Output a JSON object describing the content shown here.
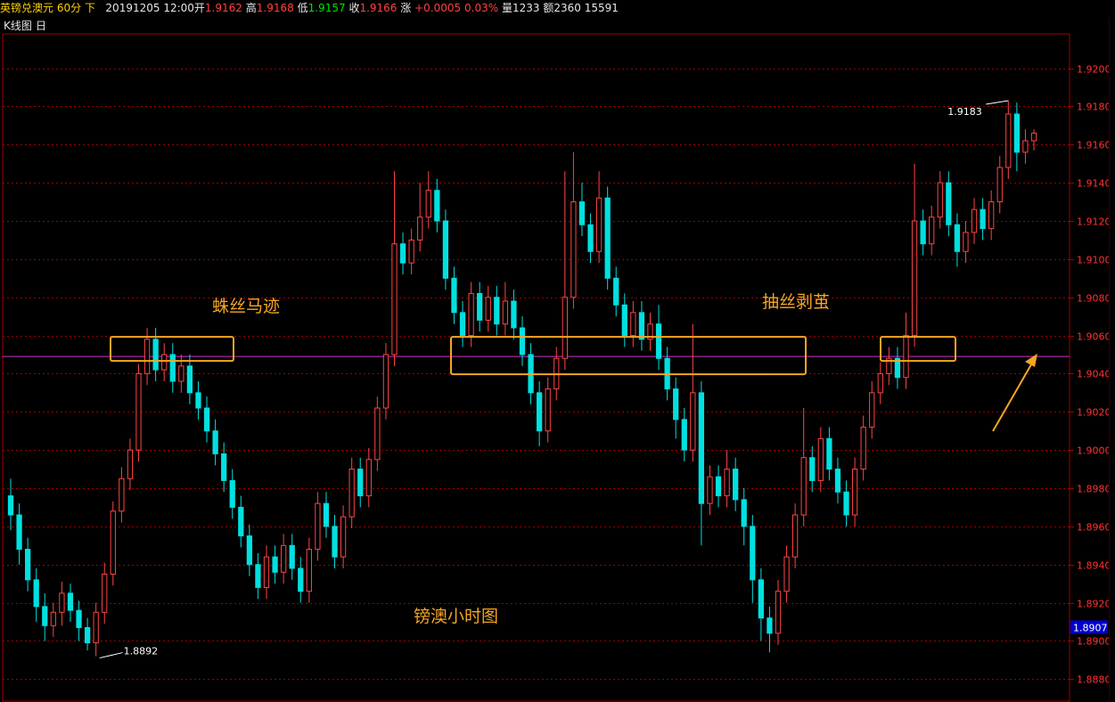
{
  "header": {
    "symbol": "英镑兑澳元",
    "period": "60分",
    "nav": "下",
    "datetime": "20191205 12:00",
    "open_label": "开",
    "open": "1.9162",
    "high_label": "高",
    "high": "1.9168",
    "low_label": "低",
    "low": "1.9157",
    "close_label": "收",
    "close": "1.9166",
    "change_label": "涨",
    "change": "+0.0005",
    "change_pct": "0.03%",
    "volume_label": "量",
    "volume": "1233",
    "amount_label": "额",
    "amount": "2360",
    "extra": "15591"
  },
  "tab": {
    "label": "K线图",
    "toggle": "日"
  },
  "colors": {
    "up": "#ff4444",
    "down": "#00e0e0",
    "grid": "#a00000",
    "axis_text": "#ff3333",
    "highlight_box": "#f5a623",
    "level_line": "#cc33cc",
    "annotation_text": "#f5a623",
    "price_tag_bg": "#0000cc"
  },
  "chart_data": {
    "type": "candlestick",
    "title": "镑澳小时图",
    "ylim": [
      1.8868,
      1.9218
    ],
    "yticks": [
      "1.9200",
      "1.9180",
      "1.9160",
      "1.9140",
      "1.9120",
      "1.9100",
      "1.9080",
      "1.9060",
      "1.9040",
      "1.9020",
      "1.9000",
      "1.8980",
      "1.8960",
      "1.8940",
      "1.8920",
      "1.8900",
      "1.8880"
    ],
    "grid": true,
    "current_price": "1.8907",
    "level_line": 1.9049,
    "high_marker": "1.9183",
    "low_marker": "1.8892",
    "annotations": [
      "蛛丝马迹",
      "抽丝剥茧",
      "镑澳小时图"
    ],
    "candles": [
      [
        1.8976,
        1.8966,
        1.8985,
        1.8958
      ],
      [
        1.8966,
        1.8948,
        1.8972,
        1.894
      ],
      [
        1.8948,
        1.8932,
        1.8954,
        1.8926
      ],
      [
        1.8932,
        1.8918,
        1.8938,
        1.891
      ],
      [
        1.8918,
        1.8908,
        1.8925,
        1.89
      ],
      [
        1.8908,
        1.8915,
        1.892,
        1.8902
      ],
      [
        1.8915,
        1.8925,
        1.8931,
        1.8908
      ],
      [
        1.8925,
        1.8916,
        1.893,
        1.891
      ],
      [
        1.8916,
        1.8907,
        1.8921,
        1.89
      ],
      [
        1.8907,
        1.8899,
        1.8912,
        1.8895
      ],
      [
        1.8899,
        1.8915,
        1.892,
        1.8892
      ],
      [
        1.8915,
        1.8935,
        1.8941,
        1.8909
      ],
      [
        1.8935,
        1.8968,
        1.8973,
        1.8929
      ],
      [
        1.8968,
        1.8985,
        1.8991,
        1.8962
      ],
      [
        1.8985,
        1.9,
        1.9006,
        1.8979
      ],
      [
        1.9,
        1.904,
        1.9045,
        1.8994
      ],
      [
        1.904,
        1.9058,
        1.9064,
        1.9034
      ],
      [
        1.9058,
        1.9042,
        1.9064,
        1.9036
      ],
      [
        1.9042,
        1.905,
        1.9056,
        1.9036
      ],
      [
        1.905,
        1.9036,
        1.9056,
        1.903
      ],
      [
        1.9036,
        1.9044,
        1.905,
        1.903
      ],
      [
        1.9044,
        1.903,
        1.905,
        1.9024
      ],
      [
        1.903,
        1.9022,
        1.9036,
        1.9016
      ],
      [
        1.9022,
        1.901,
        1.9028,
        1.9004
      ],
      [
        1.901,
        1.8998,
        1.9016,
        1.8992
      ],
      [
        1.8998,
        1.8984,
        1.9004,
        1.8978
      ],
      [
        1.8984,
        1.897,
        1.899,
        1.8964
      ],
      [
        1.897,
        1.8955,
        1.8976,
        1.8949
      ],
      [
        1.8955,
        1.894,
        1.8961,
        1.8934
      ],
      [
        1.894,
        1.8928,
        1.8946,
        1.8922
      ],
      [
        1.8928,
        1.8944,
        1.895,
        1.8922
      ],
      [
        1.8944,
        1.8936,
        1.895,
        1.893
      ],
      [
        1.8936,
        1.895,
        1.8956,
        1.893
      ],
      [
        1.895,
        1.8938,
        1.8956,
        1.8932
      ],
      [
        1.8938,
        1.8926,
        1.8944,
        1.892
      ],
      [
        1.8926,
        1.8948,
        1.8954,
        1.892
      ],
      [
        1.8948,
        1.8972,
        1.8978,
        1.8942
      ],
      [
        1.8972,
        1.896,
        1.8978,
        1.8954
      ],
      [
        1.896,
        1.8944,
        1.8966,
        1.8938
      ],
      [
        1.8944,
        1.8965,
        1.8971,
        1.8938
      ],
      [
        1.8965,
        1.899,
        1.8996,
        1.8959
      ],
      [
        1.899,
        1.8976,
        1.8996,
        1.897
      ],
      [
        1.8976,
        1.8995,
        1.9001,
        1.897
      ],
      [
        1.8995,
        1.9022,
        1.9028,
        1.8989
      ],
      [
        1.9022,
        1.905,
        1.9056,
        1.9016
      ],
      [
        1.905,
        1.9108,
        1.9146,
        1.9044
      ],
      [
        1.9108,
        1.9098,
        1.9114,
        1.9092
      ],
      [
        1.9098,
        1.911,
        1.9116,
        1.9092
      ],
      [
        1.911,
        1.9122,
        1.914,
        1.9104
      ],
      [
        1.9122,
        1.9136,
        1.9146,
        1.9116
      ],
      [
        1.9136,
        1.912,
        1.9142,
        1.9114
      ],
      [
        1.912,
        1.909,
        1.9126,
        1.9084
      ],
      [
        1.909,
        1.9072,
        1.9096,
        1.9066
      ],
      [
        1.9072,
        1.906,
        1.9078,
        1.9054
      ],
      [
        1.906,
        1.9082,
        1.9088,
        1.9054
      ],
      [
        1.9082,
        1.9068,
        1.9088,
        1.9062
      ],
      [
        1.9068,
        1.908,
        1.9086,
        1.9062
      ],
      [
        1.908,
        1.9066,
        1.9086,
        1.906
      ],
      [
        1.9066,
        1.9078,
        1.9088,
        1.906
      ],
      [
        1.9078,
        1.9064,
        1.9084,
        1.9058
      ],
      [
        1.9064,
        1.905,
        1.907,
        1.9044
      ],
      [
        1.905,
        1.903,
        1.9056,
        1.9024
      ],
      [
        1.903,
        1.901,
        1.9036,
        1.9002
      ],
      [
        1.901,
        1.9032,
        1.9038,
        1.9004
      ],
      [
        1.9032,
        1.9048,
        1.9054,
        1.9026
      ],
      [
        1.9048,
        1.908,
        1.9146,
        1.9042
      ],
      [
        1.908,
        1.913,
        1.9156,
        1.9074
      ],
      [
        1.913,
        1.9118,
        1.914,
        1.9112
      ],
      [
        1.9118,
        1.9104,
        1.9124,
        1.9098
      ],
      [
        1.9104,
        1.9132,
        1.9146,
        1.9098
      ],
      [
        1.9132,
        1.909,
        1.9138,
        1.9084
      ],
      [
        1.909,
        1.9076,
        1.9096,
        1.907
      ],
      [
        1.9076,
        1.906,
        1.9082,
        1.9054
      ],
      [
        1.906,
        1.9072,
        1.9078,
        1.9054
      ],
      [
        1.9072,
        1.9058,
        1.9078,
        1.9052
      ],
      [
        1.9058,
        1.9066,
        1.9072,
        1.9052
      ],
      [
        1.9066,
        1.9048,
        1.9076,
        1.9042
      ],
      [
        1.9048,
        1.9032,
        1.9054,
        1.9026
      ],
      [
        1.9032,
        1.9016,
        1.9038,
        1.9006
      ],
      [
        1.9016,
        1.9,
        1.9022,
        1.8994
      ],
      [
        1.9,
        1.903,
        1.9066,
        1.8994
      ],
      [
        1.903,
        1.8972,
        1.9036,
        1.895
      ],
      [
        1.8972,
        1.8986,
        1.8992,
        1.8966
      ],
      [
        1.8986,
        1.8976,
        1.8992,
        1.897
      ],
      [
        1.8976,
        1.899,
        1.9,
        1.897
      ],
      [
        1.899,
        1.8974,
        1.8996,
        1.8968
      ],
      [
        1.8974,
        1.896,
        1.898,
        1.895
      ],
      [
        1.896,
        1.8932,
        1.8966,
        1.892
      ],
      [
        1.8932,
        1.8912,
        1.8938,
        1.89
      ],
      [
        1.8912,
        1.8904,
        1.8918,
        1.8894
      ],
      [
        1.8904,
        1.8926,
        1.8932,
        1.8898
      ],
      [
        1.8926,
        1.8944,
        1.895,
        1.892
      ],
      [
        1.8944,
        1.8966,
        1.8972,
        1.8938
      ],
      [
        1.8966,
        1.8996,
        1.9022,
        1.896
      ],
      [
        1.8996,
        1.8984,
        1.9002,
        1.8978
      ],
      [
        1.8984,
        1.9006,
        1.9012,
        1.8978
      ],
      [
        1.9006,
        1.899,
        1.9012,
        1.8984
      ],
      [
        1.899,
        1.8978,
        1.8996,
        1.8972
      ],
      [
        1.8978,
        1.8966,
        1.8984,
        1.896
      ],
      [
        1.8966,
        1.899,
        1.8996,
        1.896
      ],
      [
        1.899,
        1.9012,
        1.9018,
        1.8984
      ],
      [
        1.9012,
        1.903,
        1.9036,
        1.9006
      ],
      [
        1.903,
        1.904,
        1.9046,
        1.9024
      ],
      [
        1.904,
        1.9048,
        1.9054,
        1.9034
      ],
      [
        1.9048,
        1.9038,
        1.9054,
        1.9032
      ],
      [
        1.9038,
        1.906,
        1.9072,
        1.9032
      ],
      [
        1.906,
        1.912,
        1.915,
        1.9054
      ],
      [
        1.912,
        1.9108,
        1.9126,
        1.9102
      ],
      [
        1.9108,
        1.9122,
        1.9128,
        1.9102
      ],
      [
        1.9122,
        1.914,
        1.9146,
        1.9116
      ],
      [
        1.914,
        1.9118,
        1.9146,
        1.9112
      ],
      [
        1.9118,
        1.9104,
        1.9124,
        1.9096
      ],
      [
        1.9104,
        1.9114,
        1.912,
        1.9098
      ],
      [
        1.9114,
        1.9126,
        1.9132,
        1.9108
      ],
      [
        1.9126,
        1.9116,
        1.9132,
        1.911
      ],
      [
        1.9116,
        1.913,
        1.9136,
        1.911
      ],
      [
        1.913,
        1.9148,
        1.9154,
        1.9124
      ],
      [
        1.9148,
        1.9176,
        1.9183,
        1.9142
      ],
      [
        1.9176,
        1.9156,
        1.9182,
        1.9146
      ],
      [
        1.9156,
        1.9162,
        1.9168,
        1.915
      ],
      [
        1.9162,
        1.9166,
        1.9168,
        1.9157
      ]
    ]
  }
}
